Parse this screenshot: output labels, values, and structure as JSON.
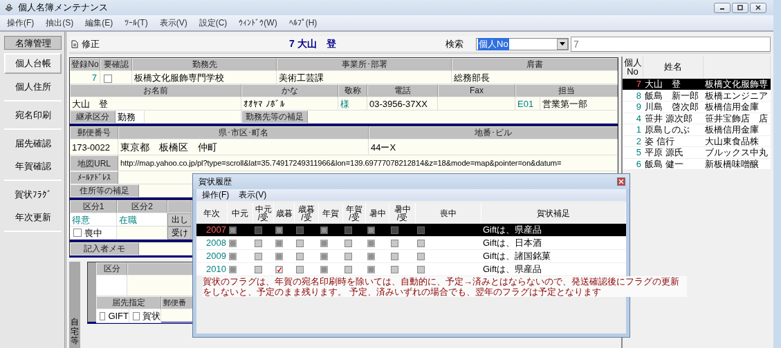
{
  "window": {
    "title": "個人名簿メンテナンス"
  },
  "menu": [
    "操作(F)",
    "抽出(S)",
    "編集(E)",
    "ﾂｰﾙ(T)",
    "表示(V)",
    "設定(C)",
    "ｳｨﾝﾄﾞｳ(W)",
    "ﾍﾙﾌﾟ(H)"
  ],
  "sidebar": {
    "header": "名簿管理",
    "groups": [
      {
        "items": [
          {
            "label": "個人台帳",
            "selected": true
          },
          {
            "label": "個人住所",
            "selected": false
          }
        ]
      },
      {
        "items": [
          {
            "label": "宛名印刷",
            "selected": false
          }
        ]
      },
      {
        "items": [
          {
            "label": "届先確認",
            "selected": false
          },
          {
            "label": "年賀確認",
            "selected": false
          }
        ]
      },
      {
        "items": [
          {
            "label": "賀状ﾌﾗｸﾞ",
            "selected": false
          },
          {
            "label": "年次更新",
            "selected": false
          }
        ]
      }
    ]
  },
  "record": {
    "mode": "修正",
    "title": "7 大山　登"
  },
  "search": {
    "label": "検索",
    "field": "個人No",
    "value": "7"
  },
  "work": {
    "headers": [
      "登録No",
      "要確認",
      "勤務先",
      "事業所･部署",
      "肩書"
    ],
    "reg_no": "7",
    "needs_check": false,
    "company": "板橋文化服飾専門学校",
    "department": "美術工芸課",
    "position": "総務部長"
  },
  "person": {
    "headers": [
      "お名前",
      "かな",
      "敬称",
      "電話",
      "Fax",
      "担当"
    ],
    "name": "大山　登",
    "kana": "ｵｵﾔﾏ ﾉﾎﾞﾙ",
    "honorific": "様",
    "phone": "03-3956-37XX",
    "staff_code": "E01",
    "staff_name": "営業第一部"
  },
  "inherit": {
    "label": "継承区分",
    "value": "勤務",
    "note_label": "勤務先等の補足"
  },
  "address": {
    "headers": [
      "郵便番号",
      "県･市区･町名",
      "地番･ビル"
    ],
    "zip": "173-0022",
    "city": "東京都　板橋区　仲町",
    "street": "44ーX",
    "map_label": "地図URL",
    "map_url": "http://map.yahoo.co.jp/pl?type=scroll&lat=35.74917249311966&lon=139.69777078212814&z=18&mode=map&pointer=on&datum=",
    "mail_label": "ﾒｰﾙｱﾄﾞﾚｽ",
    "note_label": "住所等の補足"
  },
  "classes": {
    "headers": [
      "区分1",
      "区分2"
    ],
    "values": [
      "得意",
      "在職"
    ],
    "mourning": {
      "label": "喪中",
      "checked": false
    },
    "buttons": [
      "出し",
      "受け"
    ],
    "memo_label": "記入者メモ"
  },
  "home": {
    "side_label": "自宅等",
    "header": "区分",
    "dest_label": "届先指定",
    "zip_label": "郵便番",
    "options": [
      {
        "label": "GIFT",
        "checked": false
      },
      {
        "label": "賀状",
        "checked": false
      }
    ]
  },
  "list": {
    "columns": [
      "個人No",
      "姓名"
    ],
    "rows": [
      {
        "no": "7",
        "name": "大山　登",
        "company": "板橋文化服飾専",
        "selected": true
      },
      {
        "no": "8",
        "name": "飯島　新一郎",
        "company": "板橋エンジニア",
        "selected": false
      },
      {
        "no": "9",
        "name": "川島　啓次郎",
        "company": "板橋信用金庫",
        "selected": false
      },
      {
        "no": "4",
        "name": "笹井 源次郎",
        "company": "笹井宝飾店　店",
        "selected": false
      },
      {
        "no": "1",
        "name": "原島しのぶ",
        "company": "板橋信用金庫",
        "selected": false
      },
      {
        "no": "2",
        "name": "姿 信行",
        "company": "大山東食品株",
        "selected": false
      },
      {
        "no": "5",
        "name": "平原 源氏",
        "company": "ブルックス中丸",
        "selected": false
      },
      {
        "no": "6",
        "name": "飯島 健一",
        "company": "新板橋味噌醸",
        "selected": false
      }
    ]
  },
  "dialog": {
    "title": "賀状履歴",
    "menu": [
      "操作(F)",
      "表示(V)"
    ],
    "columns": [
      "年次",
      "中元",
      "中元\n/受",
      "歳暮",
      "歳暮\n/受",
      "年賀",
      "年賀\n/受",
      "暑中",
      "暑中\n/受",
      "喪中",
      "賀状補足"
    ],
    "rows": [
      {
        "year": "2007",
        "selected": true,
        "note": "Giftは、県産品",
        "flags": [
          {
            "kind": "planned"
          },
          {
            "kind": "empty"
          },
          {
            "kind": "planned"
          },
          {
            "kind": "empty"
          },
          {
            "kind": "planned"
          },
          {
            "kind": "empty"
          },
          {
            "kind": "planned"
          },
          {
            "kind": "empty"
          },
          {
            "kind": "empty"
          }
        ]
      },
      {
        "year": "2008",
        "selected": false,
        "note": "Giftは、日本酒",
        "flags": [
          {
            "kind": "planned"
          },
          {
            "kind": "empty"
          },
          {
            "kind": "planned"
          },
          {
            "kind": "empty"
          },
          {
            "kind": "planned"
          },
          {
            "kind": "empty"
          },
          {
            "kind": "planned"
          },
          {
            "kind": "empty"
          },
          {
            "kind": "empty"
          }
        ]
      },
      {
        "year": "2009",
        "selected": false,
        "note": "Giftは、諸国銘菓",
        "flags": [
          {
            "kind": "planned"
          },
          {
            "kind": "empty"
          },
          {
            "kind": "planned"
          },
          {
            "kind": "empty"
          },
          {
            "kind": "planned"
          },
          {
            "kind": "empty"
          },
          {
            "kind": "planned"
          },
          {
            "kind": "empty"
          },
          {
            "kind": "empty"
          }
        ]
      },
      {
        "year": "2010",
        "selected": false,
        "note": "Giftは、県産品",
        "flags": [
          {
            "kind": "planned"
          },
          {
            "kind": "empty"
          },
          {
            "kind": "done"
          },
          {
            "kind": "empty"
          },
          {
            "kind": "planned"
          },
          {
            "kind": "empty"
          },
          {
            "kind": "planned"
          },
          {
            "kind": "empty"
          },
          {
            "kind": "empty"
          }
        ]
      }
    ],
    "message": "賀状のフラグは、年賀の宛名印刷時を除いては、自動的に、予定→済みとはならないので、発送確認後にフラグの更新をしないと、予定のまま残ります。 予定、済みいずれの場合でも、翌年のフラグは予定となります"
  }
}
